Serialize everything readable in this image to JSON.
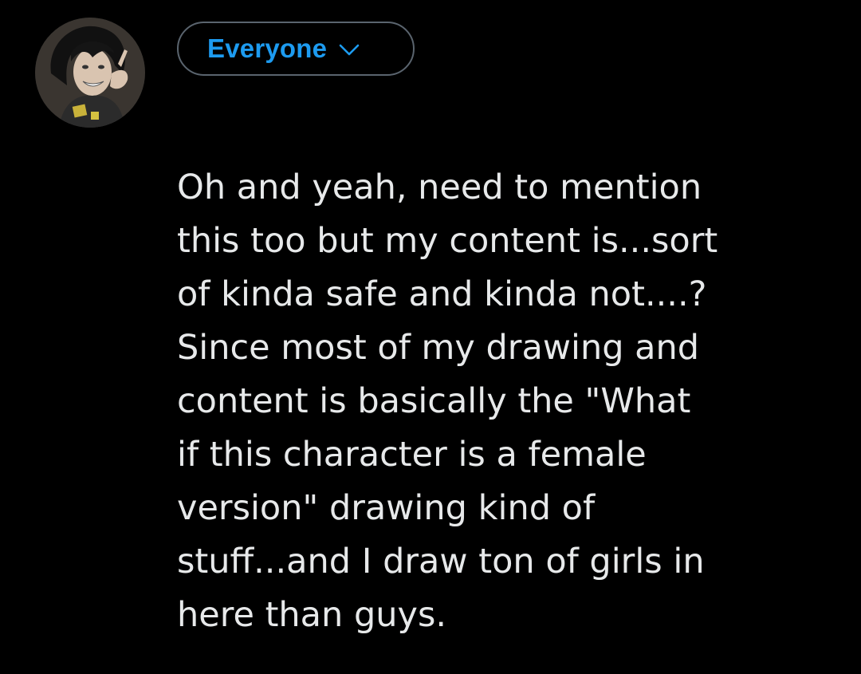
{
  "composer": {
    "avatar_icon": "user-avatar-anime-character",
    "audience": {
      "label": "Everyone",
      "icon": "chevron-down-icon",
      "color": "#1d9bf0"
    },
    "text": "Oh and yeah, need to mention\nthis too but my content is...sort\nof kinda safe and kinda not....?\nSince most of my drawing and\ncontent is basically the \"What\nif this character is a female\nversion\" drawing kind of\nstuff...and I draw ton of girls in\nhere than guys."
  },
  "colors": {
    "background": "#000000",
    "text": "#e7e9ea",
    "accent": "#1d9bf0",
    "border": "#5a646e"
  }
}
